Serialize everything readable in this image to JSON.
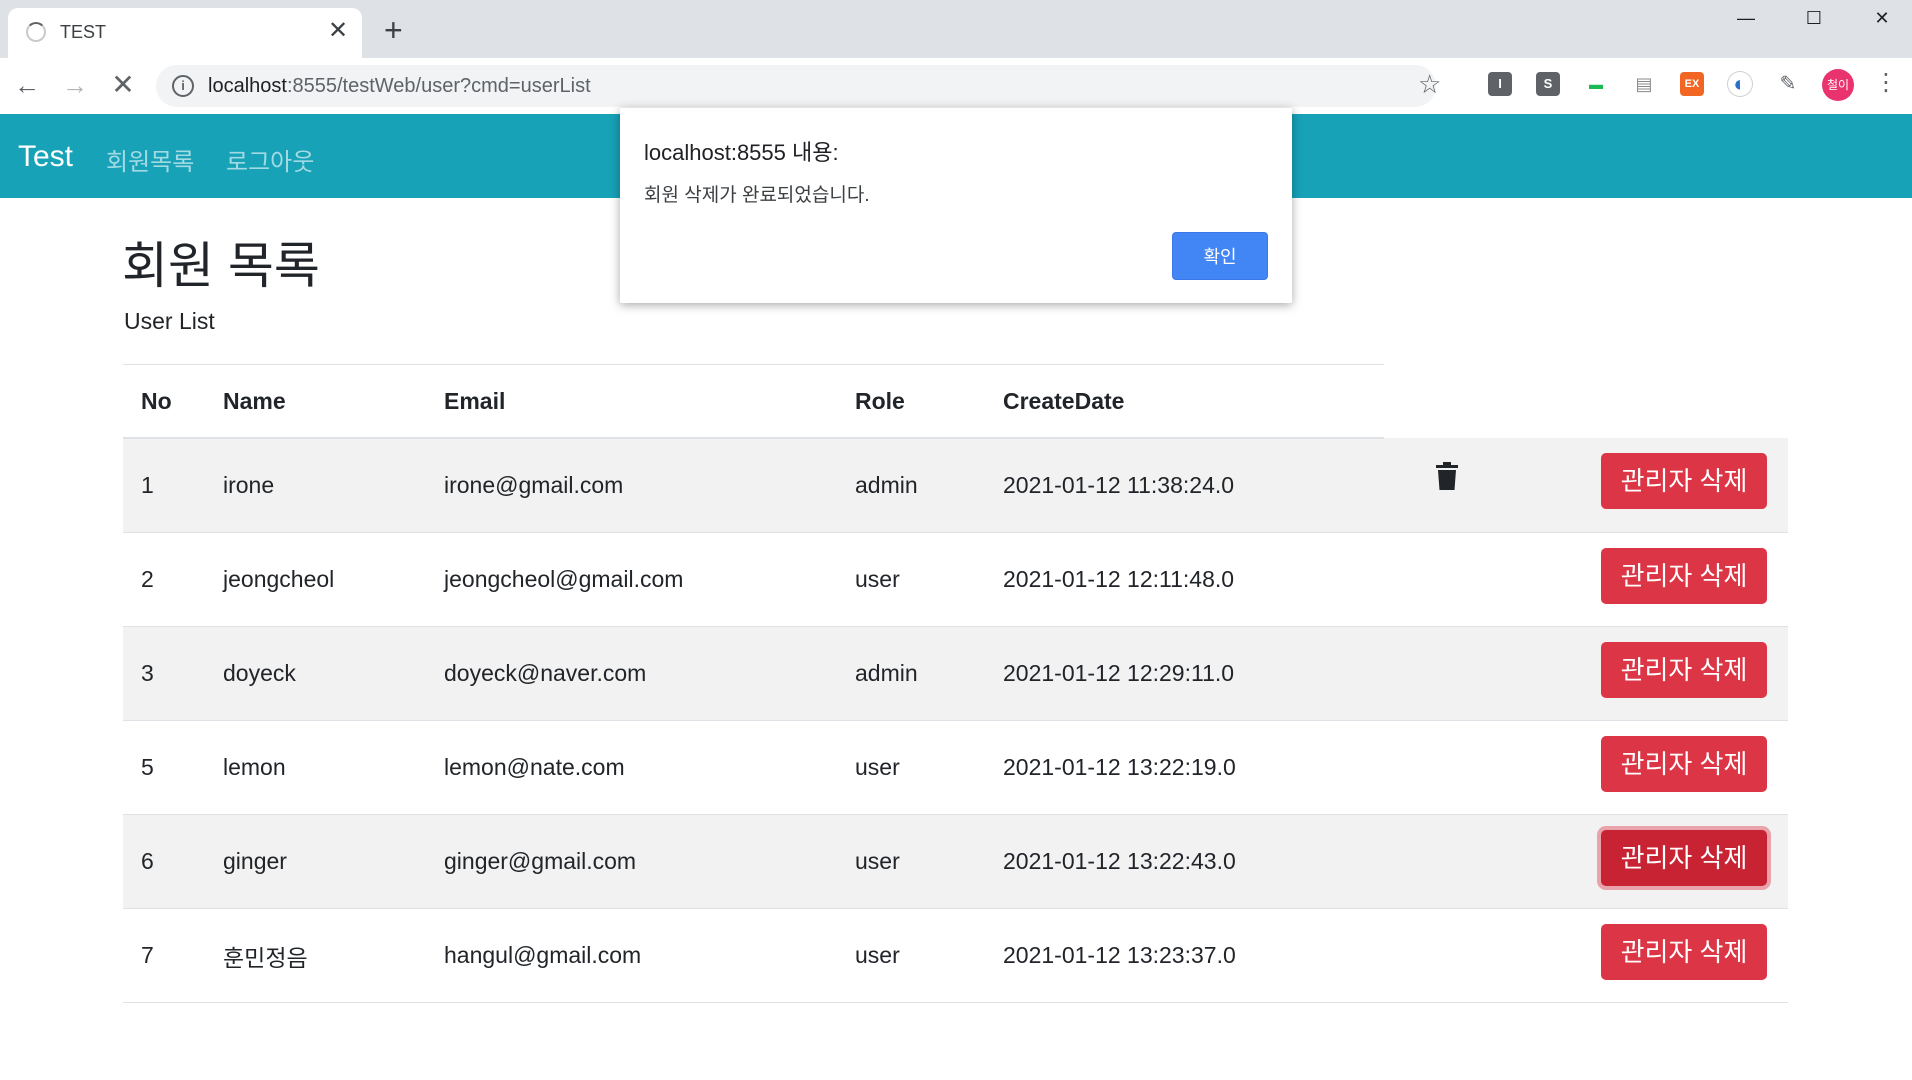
{
  "browser": {
    "tab_title": "TEST",
    "tab_close": "✕",
    "new_tab": "+",
    "url_host": "localhost",
    "url_rest": ":8555/testWeb/user?cmd=userList",
    "extensions": [
      {
        "label": "I",
        "color": "#5f6368"
      },
      {
        "label": "S",
        "color": "#5f6368"
      },
      {
        "label": "▬",
        "color": "#1db954"
      },
      {
        "label": "▤",
        "color": "#8a8a8a"
      },
      {
        "label": "EX",
        "color": "#f26522"
      },
      {
        "label": "◐",
        "color": "#2a6ec9"
      }
    ],
    "avatar_label": "철이"
  },
  "navbar": {
    "brand": "Test",
    "links": [
      "회원목록",
      "로그아웃"
    ]
  },
  "page": {
    "title": "회원 목록",
    "subtitle": "User List"
  },
  "table": {
    "headers": [
      "No",
      "Name",
      "Email",
      "Role",
      "CreateDate"
    ],
    "rows": [
      {
        "no": "1",
        "name": "irone",
        "email": "irone@gmail.com",
        "role": "admin",
        "date": "2021-01-12 11:38:24.0",
        "action": "관리자 삭제"
      },
      {
        "no": "2",
        "name": "jeongcheol",
        "email": "jeongcheol@gmail.com",
        "role": "user",
        "date": "2021-01-12 12:11:48.0",
        "action": "관리자 삭제"
      },
      {
        "no": "3",
        "name": "doyeck",
        "email": "doyeck@naver.com",
        "role": "admin",
        "date": "2021-01-12 12:29:11.0",
        "action": "관리자 삭제"
      },
      {
        "no": "5",
        "name": "lemon",
        "email": "lemon@nate.com",
        "role": "user",
        "date": "2021-01-12 13:22:19.0",
        "action": "관리자 삭제"
      },
      {
        "no": "6",
        "name": "ginger",
        "email": "ginger@gmail.com",
        "role": "user",
        "date": "2021-01-12 13:22:43.0",
        "action": "관리자 삭제"
      },
      {
        "no": "7",
        "name": "훈민정음",
        "email": "hangul@gmail.com",
        "role": "user",
        "date": "2021-01-12 13:23:37.0",
        "action": "관리자 삭제"
      }
    ]
  },
  "dialog": {
    "title": "localhost:8555 내용:",
    "message": "회원 삭제가 완료되었습니다.",
    "ok_label": "확인"
  },
  "colors": {
    "navbar": "#17a2b8",
    "danger": "#dc3545",
    "dialog_button": "#4285f4"
  }
}
